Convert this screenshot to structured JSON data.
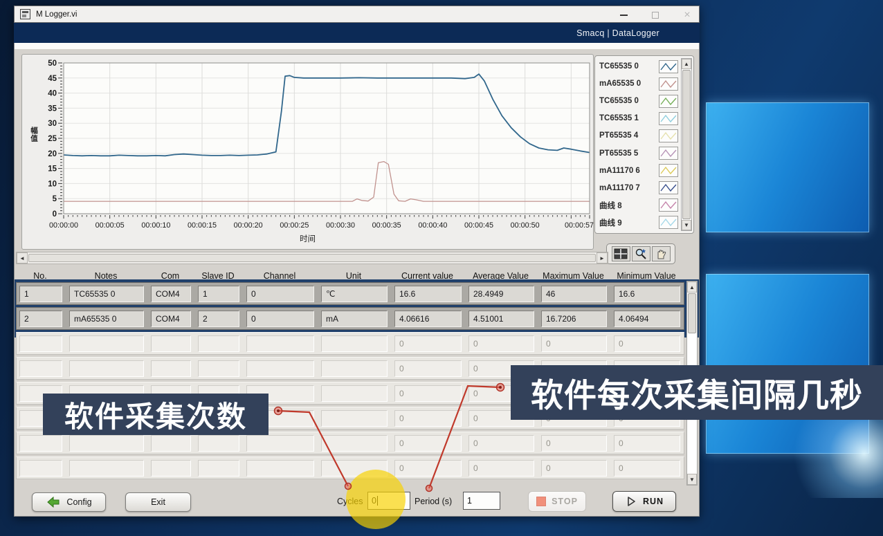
{
  "window": {
    "title": "M Logger.vi",
    "brand": "Smacq | DataLogger"
  },
  "icons": {
    "up": "▲",
    "down": "▼",
    "left": "◄",
    "right": "►",
    "close": "×"
  },
  "chart_data": {
    "type": "line",
    "title": "",
    "xlabel": "时间",
    "ylabel": "幅值",
    "xlim": [
      0,
      57
    ],
    "ylim": [
      0,
      50
    ],
    "y_tick_step": 5,
    "grid": true,
    "legend_position": "right",
    "x_ticks": [
      {
        "t": 0,
        "label": "00:00:00"
      },
      {
        "t": 5,
        "label": "00:00:05"
      },
      {
        "t": 10,
        "label": "00:00:10"
      },
      {
        "t": 15,
        "label": "00:00:15"
      },
      {
        "t": 20,
        "label": "00:00:20"
      },
      {
        "t": 25,
        "label": "00:00:25"
      },
      {
        "t": 30,
        "label": "00:00:30"
      },
      {
        "t": 35,
        "label": "00:00:35"
      },
      {
        "t": 40,
        "label": "00:00:40"
      },
      {
        "t": 45,
        "label": "00:00:45"
      },
      {
        "t": 50,
        "label": "00:00:50"
      },
      {
        "t": 57,
        "label": "00:00:57"
      }
    ],
    "series": [
      {
        "name": "TC65535 0",
        "color": "#31678c",
        "width": 1.8,
        "points": [
          [
            0,
            19.5
          ],
          [
            1,
            19.3
          ],
          [
            2,
            19.2
          ],
          [
            3,
            19.3
          ],
          [
            4,
            19.2
          ],
          [
            5,
            19.2
          ],
          [
            6,
            19.4
          ],
          [
            7,
            19.3
          ],
          [
            8,
            19.2
          ],
          [
            9,
            19.2
          ],
          [
            10,
            19.3
          ],
          [
            11,
            19.2
          ],
          [
            12,
            19.6
          ],
          [
            13,
            19.8
          ],
          [
            14,
            19.6
          ],
          [
            15,
            19.4
          ],
          [
            16,
            19.3
          ],
          [
            17,
            19.3
          ],
          [
            18,
            19.4
          ],
          [
            19,
            19.3
          ],
          [
            20,
            19.4
          ],
          [
            21,
            19.5
          ],
          [
            22,
            19.8
          ],
          [
            23,
            20.5
          ],
          [
            23.6,
            34
          ],
          [
            24,
            45.6
          ],
          [
            24.5,
            45.8
          ],
          [
            25,
            45.2
          ],
          [
            26,
            45
          ],
          [
            28,
            45
          ],
          [
            30,
            45
          ],
          [
            32,
            45.1
          ],
          [
            34,
            45
          ],
          [
            36,
            45
          ],
          [
            38,
            45
          ],
          [
            40,
            45
          ],
          [
            42,
            45
          ],
          [
            43.5,
            44.8
          ],
          [
            44.5,
            45.2
          ],
          [
            45,
            46.3
          ],
          [
            45.6,
            44
          ],
          [
            46.5,
            38
          ],
          [
            47.5,
            32.5
          ],
          [
            48.5,
            28.5
          ],
          [
            49.5,
            25.5
          ],
          [
            50.5,
            23.2
          ],
          [
            51.5,
            21.8
          ],
          [
            52.5,
            21.2
          ],
          [
            53.5,
            21
          ],
          [
            54.2,
            21.8
          ],
          [
            55,
            21.4
          ],
          [
            56,
            20.8
          ],
          [
            57,
            20.3
          ]
        ]
      },
      {
        "name": "mA65535 0",
        "color": "#c1928e",
        "width": 1.3,
        "points": [
          [
            0,
            4.1
          ],
          [
            5,
            4.1
          ],
          [
            10,
            4.1
          ],
          [
            15,
            4.1
          ],
          [
            20,
            4.1
          ],
          [
            25,
            4.1
          ],
          [
            30,
            4.1
          ],
          [
            31.3,
            4.1
          ],
          [
            31.8,
            4.9
          ],
          [
            32.3,
            4.4
          ],
          [
            33,
            4.2
          ],
          [
            33.6,
            5.5
          ],
          [
            34.1,
            16.9
          ],
          [
            34.7,
            17.3
          ],
          [
            35.2,
            16.4
          ],
          [
            35.8,
            6.5
          ],
          [
            36.3,
            4.3
          ],
          [
            37,
            4.1
          ],
          [
            37.6,
            4.9
          ],
          [
            38.2,
            4.6
          ],
          [
            39,
            4.1
          ],
          [
            42,
            4.1
          ],
          [
            46,
            4.1
          ],
          [
            50,
            4.1
          ],
          [
            54,
            4.1
          ],
          [
            57,
            4.1
          ]
        ]
      }
    ]
  },
  "legend": {
    "items": [
      {
        "label": "TC65535 0",
        "color": "#31678c"
      },
      {
        "label": "mA65535 0",
        "color": "#c1928e"
      },
      {
        "label": "TC65535 0",
        "color": "#77b05a"
      },
      {
        "label": "TC65535 1",
        "color": "#8fcfdf"
      },
      {
        "label": "PT65535 4",
        "color": "#e6e2ae"
      },
      {
        "label": "PT65535 5",
        "color": "#b794b7"
      },
      {
        "label": "mA11170 6",
        "color": "#ddcb5a"
      },
      {
        "label": "mA11170 7",
        "color": "#39508e"
      },
      {
        "label": "曲线 8",
        "color": "#c583ab"
      },
      {
        "label": "曲线 9",
        "color": "#a6d9e9"
      }
    ]
  },
  "table": {
    "headers": [
      "No.",
      "Notes",
      "Com",
      "Slave ID",
      "Channel",
      "Unit",
      "Current value",
      "Average Value",
      "Maximum Value",
      "Minimum Value"
    ],
    "rows": [
      [
        "1",
        "TC65535 0",
        "COM4",
        "1",
        "0",
        "℃",
        "16.6",
        "28.4949",
        "46",
        "16.6"
      ],
      [
        "2",
        "mA65535 0",
        "COM4",
        "2",
        "0",
        "mA",
        "4.06616",
        "4.51001",
        "16.7206",
        "4.06494"
      ]
    ],
    "empty_rows": {
      "count": 6,
      "values": [
        "",
        "",
        "",
        "",
        "",
        "",
        "0",
        "0",
        "0",
        "0"
      ]
    }
  },
  "controls": {
    "config": "Config",
    "exit": "Exit",
    "cycles_label": "Cycles",
    "cycles_value": "0",
    "period_label": "Period  (s)",
    "period_value": "1",
    "stop": "STOP",
    "run": "RUN"
  },
  "callouts": {
    "left_label": "软件采集次数",
    "right_label": "软件每次采集间隔几秒"
  }
}
